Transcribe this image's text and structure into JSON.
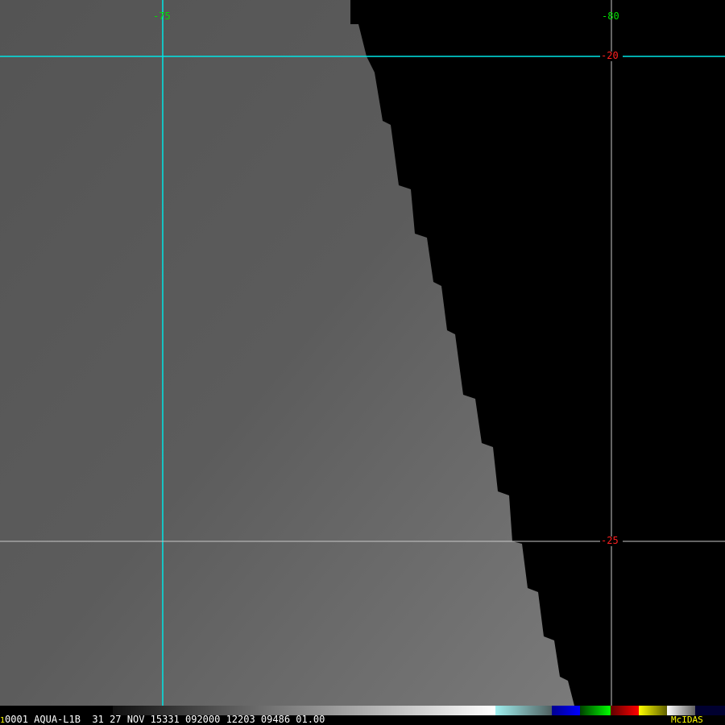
{
  "image": {
    "satellite_view": "AQUA IR imagery",
    "colors": {
      "cyan": "#00e5e5",
      "grid_gray": "#c8c8c8",
      "lon_label": "#00e000",
      "lat_label": "#ff2020",
      "mcidas": "#ffff00"
    }
  },
  "grid": {
    "lon_labels": [
      "-75",
      "-80"
    ],
    "lat_labels": [
      "-20",
      "-25"
    ]
  },
  "status_bar": {
    "frame_number": "1",
    "text": "0001 AQUA-L1B  31 27 NOV 15331 092000 12203 09486 01.00",
    "brand": "McIDAS"
  }
}
